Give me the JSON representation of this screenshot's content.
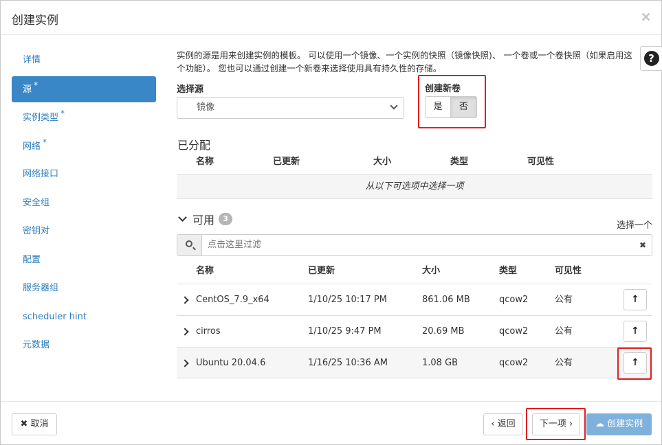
{
  "modal": {
    "title": "创建实例",
    "close": "×"
  },
  "sidebar": {
    "items": [
      {
        "label": "详情",
        "required": ""
      },
      {
        "label": "源",
        "required": "*"
      },
      {
        "label": "实例类型",
        "required": "*"
      },
      {
        "label": "网络",
        "required": "*"
      },
      {
        "label": "网络接口",
        "required": ""
      },
      {
        "label": "安全组",
        "required": ""
      },
      {
        "label": "密钥对",
        "required": ""
      },
      {
        "label": "配置",
        "required": ""
      },
      {
        "label": "服务器组",
        "required": ""
      },
      {
        "label": "scheduler hint",
        "required": ""
      },
      {
        "label": "元数据",
        "required": ""
      }
    ],
    "active_index": 1
  },
  "source": {
    "description": "实例的源是用来创建实例的模板。 可以使用一个镜像、一个实例的快照（镜像快照)、 一个卷或一个卷快照（如果启用这个功能）。 您也可以通过创建一个新卷来选择使用具有持久性的存储。",
    "select_label": "选择源",
    "select_value": "镜像",
    "new_volume_label": "创建新卷",
    "yes": "是",
    "no": "否"
  },
  "allocated": {
    "title": "已分配",
    "columns": [
      "名称",
      "已更新",
      "大小",
      "类型",
      "可见性"
    ],
    "empty_text": "从以下可选项中选择一项"
  },
  "available": {
    "title": "可用",
    "count": "3",
    "select_one": "选择一个",
    "filter_placeholder": "点击这里过滤",
    "columns": [
      "名称",
      "已更新",
      "大小",
      "类型",
      "可见性"
    ],
    "rows": [
      {
        "name": "CentOS_7.9_x64",
        "updated": "1/10/25 10:17 PM",
        "size": "861.06 MB",
        "type": "qcow2",
        "visibility": "公有"
      },
      {
        "name": "cirros",
        "updated": "1/10/25 9:47 PM",
        "size": "20.69 MB",
        "type": "qcow2",
        "visibility": "公有"
      },
      {
        "name": "Ubuntu 20.04.6",
        "updated": "1/16/25 10:36 AM",
        "size": "1.08 GB",
        "type": "qcow2",
        "visibility": "公有"
      }
    ]
  },
  "footer": {
    "cancel": "取消",
    "back": "返回",
    "next": "下一项",
    "create": "创建实例"
  },
  "colors": {
    "accent": "#3a87c8",
    "highlight": "#e01f1f",
    "primary_disabled": "#7fb1dd"
  }
}
